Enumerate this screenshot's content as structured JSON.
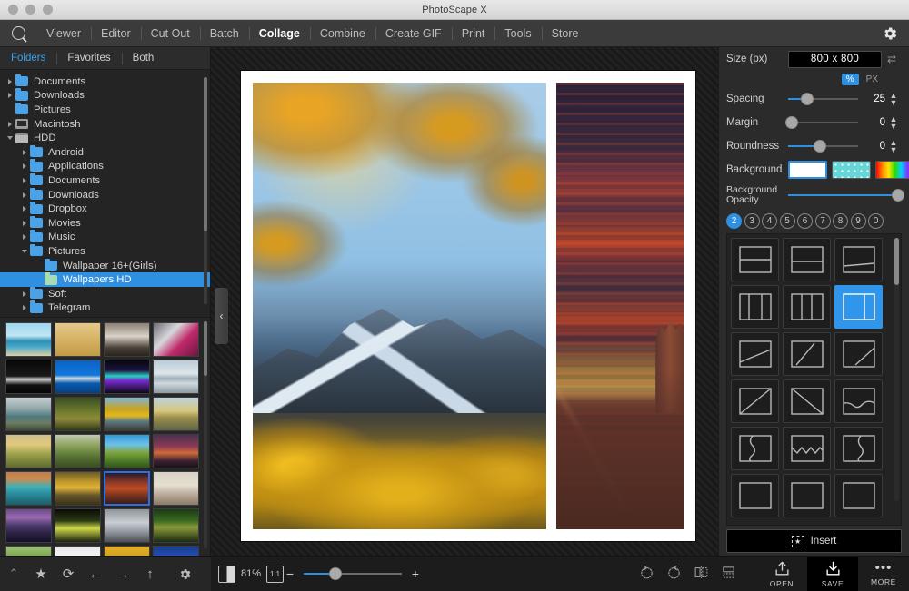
{
  "window": {
    "title": "PhotoScape X",
    "traffic_lights": [
      "close",
      "minimize",
      "maximize"
    ]
  },
  "menubar": {
    "logo": "photoscape-logo",
    "items": [
      {
        "label": "Viewer",
        "active": false
      },
      {
        "label": "Editor",
        "active": false
      },
      {
        "label": "Cut Out",
        "active": false
      },
      {
        "label": "Batch",
        "active": false
      },
      {
        "label": "Collage",
        "active": true
      },
      {
        "label": "Combine",
        "active": false
      },
      {
        "label": "Create GIF",
        "active": false
      },
      {
        "label": "Print",
        "active": false
      },
      {
        "label": "Tools",
        "active": false
      },
      {
        "label": "Store",
        "active": false
      }
    ],
    "settings_icon": "gear-icon"
  },
  "left_panel": {
    "tabs": [
      {
        "label": "Folders",
        "active": true
      },
      {
        "label": "Favorites",
        "active": false
      },
      {
        "label": "Both",
        "active": false
      }
    ],
    "tree": [
      {
        "label": "Documents",
        "indent": 0,
        "arrow": "right",
        "icon": "folder",
        "selected": false
      },
      {
        "label": "Downloads",
        "indent": 0,
        "arrow": "right",
        "icon": "folder",
        "selected": false
      },
      {
        "label": "Pictures",
        "indent": 0,
        "arrow": "none",
        "icon": "folder",
        "selected": false
      },
      {
        "label": "Macintosh",
        "indent": 0,
        "arrow": "right",
        "icon": "mac",
        "selected": false
      },
      {
        "label": "HDD",
        "indent": 0,
        "arrow": "down",
        "icon": "disk",
        "selected": false
      },
      {
        "label": "Android",
        "indent": 1,
        "arrow": "right",
        "icon": "folder",
        "selected": false
      },
      {
        "label": "Applications",
        "indent": 1,
        "arrow": "right",
        "icon": "folder",
        "selected": false
      },
      {
        "label": "Documents",
        "indent": 1,
        "arrow": "right",
        "icon": "folder",
        "selected": false
      },
      {
        "label": "Downloads",
        "indent": 1,
        "arrow": "right",
        "icon": "folder",
        "selected": false
      },
      {
        "label": "Dropbox",
        "indent": 1,
        "arrow": "right",
        "icon": "folder",
        "selected": false
      },
      {
        "label": "Movies",
        "indent": 1,
        "arrow": "right",
        "icon": "folder",
        "selected": false
      },
      {
        "label": "Music",
        "indent": 1,
        "arrow": "right",
        "icon": "folder",
        "selected": false
      },
      {
        "label": "Pictures",
        "indent": 1,
        "arrow": "down",
        "icon": "folder",
        "selected": false
      },
      {
        "label": "Wallpaper 16+(Girls)",
        "indent": 2,
        "arrow": "none",
        "icon": "folder",
        "selected": false
      },
      {
        "label": "Wallpapers HD",
        "indent": 2,
        "arrow": "none",
        "icon": "folder",
        "selected": true
      },
      {
        "label": "Soft",
        "indent": 1,
        "arrow": "right",
        "icon": "folder",
        "selected": false
      },
      {
        "label": "Telegram",
        "indent": 1,
        "arrow": "right",
        "icon": "folder",
        "selected": false
      }
    ],
    "thumbnails": [
      {
        "name": "beach-palms",
        "selected": false
      },
      {
        "name": "wheat-field",
        "selected": false
      },
      {
        "name": "sneakers",
        "selected": false
      },
      {
        "name": "pink-car",
        "selected": false
      },
      {
        "name": "night-road",
        "selected": false
      },
      {
        "name": "blue-fish",
        "selected": false
      },
      {
        "name": "aurora",
        "selected": false
      },
      {
        "name": "lake-sunrise",
        "selected": false
      },
      {
        "name": "coast-rocks",
        "selected": false
      },
      {
        "name": "forest-leaves",
        "selected": false
      },
      {
        "name": "autumn-mountain",
        "selected": false
      },
      {
        "name": "autumn-river",
        "selected": false
      },
      {
        "name": "golden-field",
        "selected": false
      },
      {
        "name": "green-canyon",
        "selected": false
      },
      {
        "name": "vineyard",
        "selected": false
      },
      {
        "name": "city-dusk",
        "selected": false
      },
      {
        "name": "turquoise-bay",
        "selected": false
      },
      {
        "name": "valley-sunset",
        "selected": false
      },
      {
        "name": "desert-sunset",
        "selected": true
      },
      {
        "name": "2020-people",
        "selected": false
      },
      {
        "name": "purple-lake",
        "selected": false
      },
      {
        "name": "yellow-flowers",
        "selected": false
      },
      {
        "name": "silver-supercar",
        "selected": false
      },
      {
        "name": "butterfly",
        "selected": false
      },
      {
        "name": "green-hills",
        "selected": false
      },
      {
        "name": "white-snow",
        "selected": false
      },
      {
        "name": "golden-dunes",
        "selected": false
      },
      {
        "name": "blue-gradient",
        "selected": false
      }
    ]
  },
  "canvas": {
    "collapse_handle": "‹",
    "cells": [
      {
        "name": "autumn-larch-mountain"
      },
      {
        "name": "desert-sunset-butte"
      }
    ]
  },
  "right_panel": {
    "size_label": "Size (px)",
    "size_value": "800 x 800",
    "swap_icon": "swap-icon",
    "units": [
      {
        "label": "%",
        "active": true
      },
      {
        "label": "PX",
        "active": false
      }
    ],
    "sliders": [
      {
        "label": "Spacing",
        "value": "25",
        "pct": 27,
        "fill": true
      },
      {
        "label": "Margin",
        "value": "0",
        "pct": 0,
        "fill": false
      },
      {
        "label": "Roundness",
        "value": "0",
        "pct": 45,
        "fill": true
      }
    ],
    "background_label": "Background",
    "background_swatches": [
      {
        "name": "white-swatch",
        "selected": true
      },
      {
        "name": "pattern-swatch",
        "selected": false
      },
      {
        "name": "gradient-swatch",
        "selected": false
      }
    ],
    "background_opacity_label_line1": "Background",
    "background_opacity_label_line2": "Opacity",
    "background_opacity_pct": 97,
    "counts": [
      {
        "label": "2",
        "active": true
      },
      {
        "label": "3",
        "active": false
      },
      {
        "label": "4",
        "active": false
      },
      {
        "label": "5",
        "active": false
      },
      {
        "label": "6",
        "active": false
      },
      {
        "label": "7",
        "active": false
      },
      {
        "label": "8",
        "active": false
      },
      {
        "label": "9",
        "active": false
      },
      {
        "label": "0",
        "active": false
      }
    ],
    "templates": [
      {
        "name": "split-horizontal-even",
        "selected": false
      },
      {
        "name": "split-horizontal-top-heavy",
        "selected": false
      },
      {
        "name": "split-horizontal-bottom-thin",
        "selected": false
      },
      {
        "name": "split-vertical-even",
        "selected": false
      },
      {
        "name": "split-vertical-left-wide",
        "selected": false
      },
      {
        "name": "split-vertical-right-thin",
        "selected": true
      },
      {
        "name": "split-diagonal-shallow",
        "selected": false
      },
      {
        "name": "split-diagonal-steep",
        "selected": false
      },
      {
        "name": "split-diagonal-corner",
        "selected": false
      },
      {
        "name": "split-diagonal-full",
        "selected": false
      },
      {
        "name": "split-diagonal-reverse",
        "selected": false
      },
      {
        "name": "split-wave-horizontal",
        "selected": false
      },
      {
        "name": "split-wave-vertical-left",
        "selected": false
      },
      {
        "name": "split-zigzag-horizontal",
        "selected": false
      },
      {
        "name": "split-wave-vertical-right",
        "selected": false
      },
      {
        "name": "split-flat-a",
        "selected": false
      },
      {
        "name": "split-flat-b",
        "selected": false
      },
      {
        "name": "split-flat-c",
        "selected": false
      }
    ],
    "insert_label": "Insert",
    "insert_icon": "insert-star-icon"
  },
  "bottom_bar": {
    "left_icons": [
      {
        "name": "collapse-chevron-icon",
        "glyph": "⌃"
      },
      {
        "name": "favorite-star-icon",
        "glyph": "★"
      },
      {
        "name": "refresh-icon",
        "glyph": "⟳"
      },
      {
        "name": "back-arrow-icon",
        "glyph": "←"
      },
      {
        "name": "forward-arrow-icon",
        "glyph": "→"
      },
      {
        "name": "up-arrow-icon",
        "glyph": "↑"
      },
      {
        "name": "settings-gear-icon",
        "glyph": "⚙"
      }
    ],
    "view_toggle_icon": "split-view-icon",
    "zoom_percent": "81%",
    "one_to_one_label": "1:1",
    "zoom_minus": "−",
    "zoom_plus": "+",
    "tools": [
      {
        "name": "rotate-left-icon",
        "glyph": "↺"
      },
      {
        "name": "rotate-right-icon",
        "glyph": "↻"
      },
      {
        "name": "flip-horizontal-icon",
        "glyph": "flip"
      },
      {
        "name": "flip-vertical-icon",
        "glyph": "flipv"
      }
    ],
    "actions": [
      {
        "name": "open-button",
        "label": "OPEN",
        "icon": "upload-icon",
        "dark": false
      },
      {
        "name": "save-button",
        "label": "SAVE",
        "icon": "download-icon",
        "dark": true
      },
      {
        "name": "more-button",
        "label": "MORE",
        "icon": "ellipsis-icon",
        "dark": false
      }
    ]
  },
  "colors": {
    "accent": "#2f8fe0",
    "panel_bg": "#2b2b2b",
    "left_bg": "#242424",
    "menubar_bg": "#3b3b3b",
    "selected_row": "#2f8fe0"
  }
}
